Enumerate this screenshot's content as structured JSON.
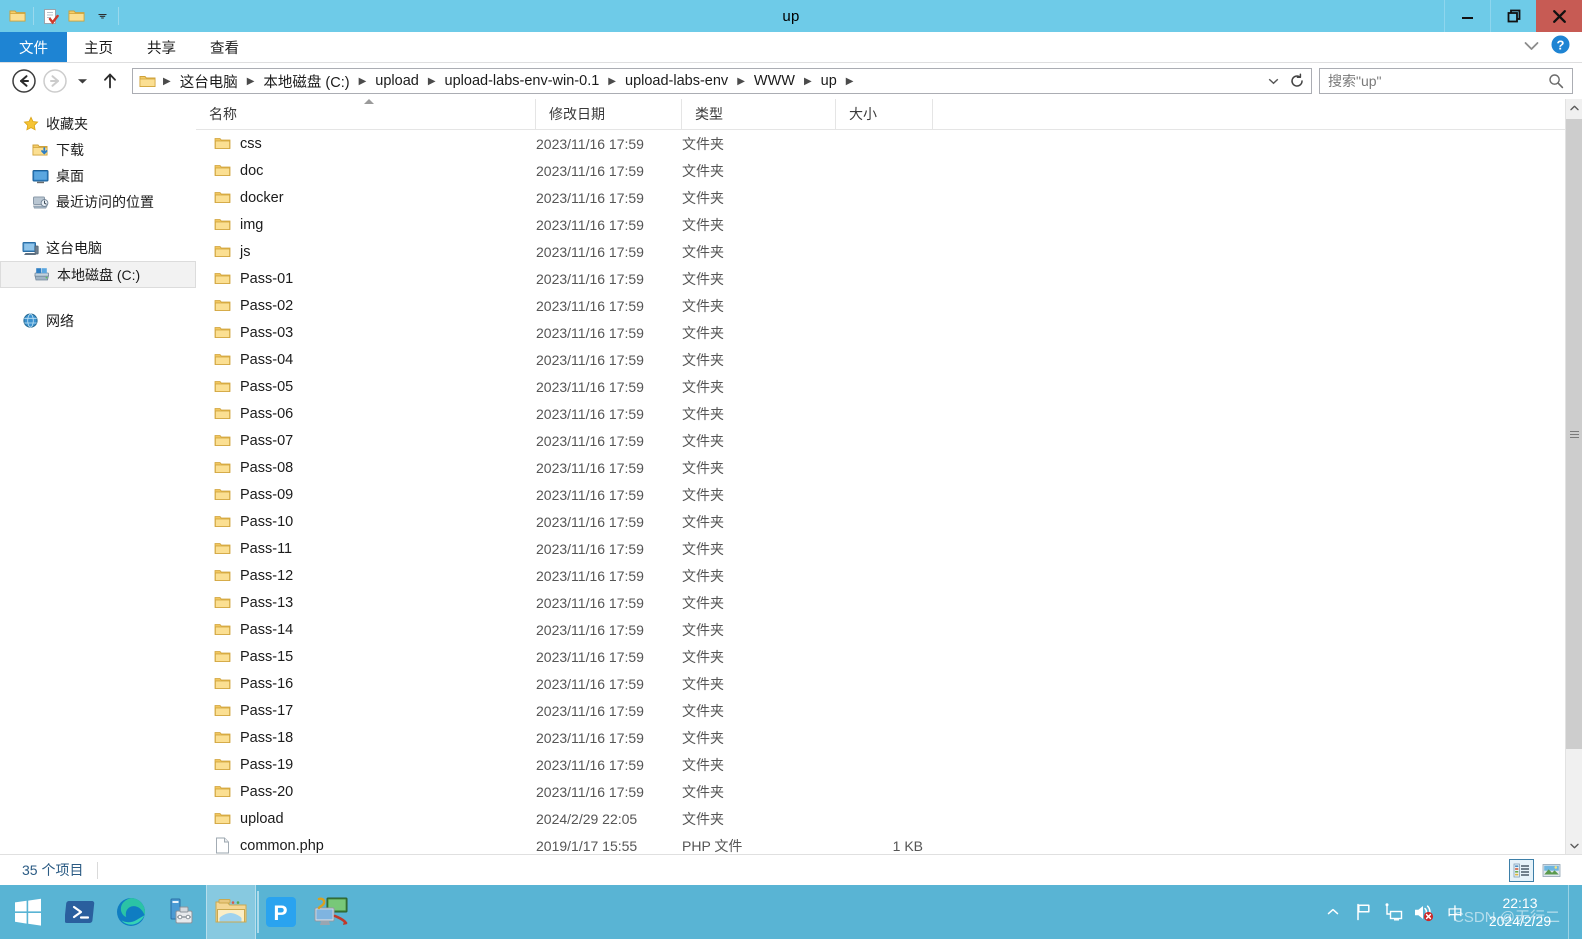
{
  "window": {
    "title": "up",
    "quick_access": [
      "folder-icon",
      "properties-icon",
      "new-folder-icon",
      "customize-dropdown-icon"
    ],
    "controls": {
      "minimize": "minimize-icon",
      "restore": "restore-icon",
      "close": "close-icon"
    }
  },
  "ribbon": {
    "tabs": [
      {
        "label": "文件",
        "active": true
      },
      {
        "label": "主页",
        "active": false
      },
      {
        "label": "共享",
        "active": false
      },
      {
        "label": "查看",
        "active": false
      }
    ],
    "expand": "chevron-down-icon",
    "help": "help-icon"
  },
  "address": {
    "back": "back-arrow-icon",
    "forward": "forward-arrow-icon",
    "recent": "recent-locations-icon",
    "up": "up-arrow-icon",
    "crumbs": [
      "这台电脑",
      "本地磁盘 (C:)",
      "upload",
      "upload-labs-env-win-0.1",
      "upload-labs-env",
      "WWW",
      "up"
    ],
    "dropdown": "chevron-down-icon",
    "refresh": "refresh-icon"
  },
  "search": {
    "placeholder": "搜索\"up\"",
    "value": "",
    "icon": "search-icon"
  },
  "sidebar": {
    "groups": [
      {
        "header": {
          "label": "收藏夹",
          "icon": "star-icon"
        },
        "items": [
          {
            "label": "下载",
            "icon": "downloads-icon"
          },
          {
            "label": "桌面",
            "icon": "desktop-icon"
          },
          {
            "label": "最近访问的位置",
            "icon": "recent-places-icon"
          }
        ]
      },
      {
        "header": {
          "label": "这台电脑",
          "icon": "computer-icon"
        },
        "items": [
          {
            "label": "本地磁盘 (C:)",
            "icon": "drive-icon",
            "selected": true
          }
        ]
      },
      {
        "header": {
          "label": "网络",
          "icon": "network-icon"
        },
        "items": []
      }
    ]
  },
  "columns": [
    {
      "key": "name",
      "label": "名称",
      "sorted": "asc"
    },
    {
      "key": "date",
      "label": "修改日期"
    },
    {
      "key": "type",
      "label": "类型"
    },
    {
      "key": "size",
      "label": "大小"
    }
  ],
  "files": [
    {
      "name": "css",
      "date": "2023/11/16 17:59",
      "type": "文件夹",
      "size": "",
      "icon": "folder-icon"
    },
    {
      "name": "doc",
      "date": "2023/11/16 17:59",
      "type": "文件夹",
      "size": "",
      "icon": "folder-icon"
    },
    {
      "name": "docker",
      "date": "2023/11/16 17:59",
      "type": "文件夹",
      "size": "",
      "icon": "folder-icon"
    },
    {
      "name": "img",
      "date": "2023/11/16 17:59",
      "type": "文件夹",
      "size": "",
      "icon": "folder-icon"
    },
    {
      "name": "js",
      "date": "2023/11/16 17:59",
      "type": "文件夹",
      "size": "",
      "icon": "folder-icon"
    },
    {
      "name": "Pass-01",
      "date": "2023/11/16 17:59",
      "type": "文件夹",
      "size": "",
      "icon": "folder-icon"
    },
    {
      "name": "Pass-02",
      "date": "2023/11/16 17:59",
      "type": "文件夹",
      "size": "",
      "icon": "folder-icon"
    },
    {
      "name": "Pass-03",
      "date": "2023/11/16 17:59",
      "type": "文件夹",
      "size": "",
      "icon": "folder-icon"
    },
    {
      "name": "Pass-04",
      "date": "2023/11/16 17:59",
      "type": "文件夹",
      "size": "",
      "icon": "folder-icon"
    },
    {
      "name": "Pass-05",
      "date": "2023/11/16 17:59",
      "type": "文件夹",
      "size": "",
      "icon": "folder-icon"
    },
    {
      "name": "Pass-06",
      "date": "2023/11/16 17:59",
      "type": "文件夹",
      "size": "",
      "icon": "folder-icon"
    },
    {
      "name": "Pass-07",
      "date": "2023/11/16 17:59",
      "type": "文件夹",
      "size": "",
      "icon": "folder-icon"
    },
    {
      "name": "Pass-08",
      "date": "2023/11/16 17:59",
      "type": "文件夹",
      "size": "",
      "icon": "folder-icon"
    },
    {
      "name": "Pass-09",
      "date": "2023/11/16 17:59",
      "type": "文件夹",
      "size": "",
      "icon": "folder-icon"
    },
    {
      "name": "Pass-10",
      "date": "2023/11/16 17:59",
      "type": "文件夹",
      "size": "",
      "icon": "folder-icon"
    },
    {
      "name": "Pass-11",
      "date": "2023/11/16 17:59",
      "type": "文件夹",
      "size": "",
      "icon": "folder-icon"
    },
    {
      "name": "Pass-12",
      "date": "2023/11/16 17:59",
      "type": "文件夹",
      "size": "",
      "icon": "folder-icon"
    },
    {
      "name": "Pass-13",
      "date": "2023/11/16 17:59",
      "type": "文件夹",
      "size": "",
      "icon": "folder-icon"
    },
    {
      "name": "Pass-14",
      "date": "2023/11/16 17:59",
      "type": "文件夹",
      "size": "",
      "icon": "folder-icon"
    },
    {
      "name": "Pass-15",
      "date": "2023/11/16 17:59",
      "type": "文件夹",
      "size": "",
      "icon": "folder-icon"
    },
    {
      "name": "Pass-16",
      "date": "2023/11/16 17:59",
      "type": "文件夹",
      "size": "",
      "icon": "folder-icon"
    },
    {
      "name": "Pass-17",
      "date": "2023/11/16 17:59",
      "type": "文件夹",
      "size": "",
      "icon": "folder-icon"
    },
    {
      "name": "Pass-18",
      "date": "2023/11/16 17:59",
      "type": "文件夹",
      "size": "",
      "icon": "folder-icon"
    },
    {
      "name": "Pass-19",
      "date": "2023/11/16 17:59",
      "type": "文件夹",
      "size": "",
      "icon": "folder-icon"
    },
    {
      "name": "Pass-20",
      "date": "2023/11/16 17:59",
      "type": "文件夹",
      "size": "",
      "icon": "folder-icon"
    },
    {
      "name": "upload",
      "date": "2024/2/29 22:05",
      "type": "文件夹",
      "size": "",
      "icon": "folder-icon"
    },
    {
      "name": "common.php",
      "date": "2019/1/17 15:55",
      "type": "PHP 文件",
      "size": "1 KB",
      "icon": "php-file-icon"
    }
  ],
  "status": {
    "item_count": "35 个项目",
    "views": [
      {
        "name": "details-view",
        "active": true
      },
      {
        "name": "large-icons-view",
        "active": false
      }
    ]
  },
  "taskbar": {
    "start": "windows-start-icon",
    "apps": [
      {
        "name": "powershell-icon",
        "running": false
      },
      {
        "name": "edge-browser-icon",
        "running": false
      },
      {
        "name": "server-manager-icon",
        "running": false
      },
      {
        "name": "file-explorer-icon",
        "running": true
      },
      {
        "name": "phpstudy-icon",
        "running": false
      },
      {
        "name": "php-monitor-icon",
        "running": false
      }
    ],
    "tray": {
      "expand": "tray-expand-icon",
      "icons": [
        "action-center-flag-icon",
        "network-icon",
        "volume-muted-icon"
      ],
      "ime": "中",
      "time": "22:13",
      "date": "2024/2/29"
    },
    "watermark": "CSDN @无行二"
  },
  "colors": {
    "titlebar": "#6ecbe8",
    "taskbar": "#59b4d4",
    "accent": "#1e84d3",
    "close": "#c75b54",
    "selection": "#e5f3fb",
    "folder": "#f7ce6a"
  }
}
